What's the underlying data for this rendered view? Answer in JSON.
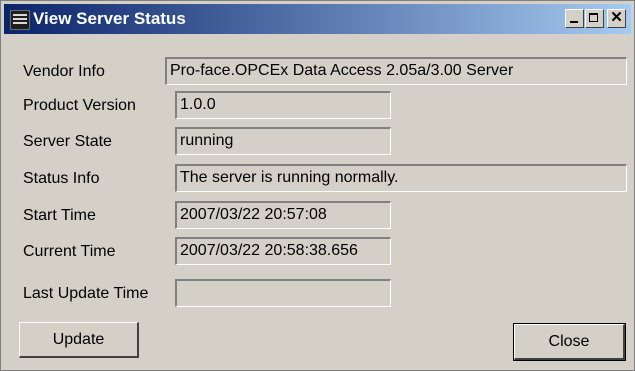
{
  "window": {
    "title": "View Server Status",
    "icon": "app-icon"
  },
  "titlebar_buttons": {
    "minimize_icon": "minimize-icon",
    "maximize_icon": "maximize-icon",
    "close_icon": "close-icon",
    "close_glyph": "✕"
  },
  "fields": [
    {
      "label": "Vendor Info",
      "value": "Pro-face.OPCEx Data Access 2.05a/3.00 Server"
    },
    {
      "label": "Product Version",
      "value": "1.0.0"
    },
    {
      "label": "Server State",
      "value": "running"
    },
    {
      "label": "Status Info",
      "value": "The server is running normally."
    },
    {
      "label": "Start Time",
      "value": "2007/03/22 20:57:08"
    },
    {
      "label": "Current Time",
      "value": "2007/03/22 20:58:38.656"
    },
    {
      "label": "Last Update Time",
      "value": ""
    }
  ],
  "buttons": {
    "update_label": "Update",
    "close_label": "Close"
  },
  "colors": {
    "titlebar_start": "#0a246a",
    "titlebar_end": "#a6caf0",
    "face": "#d4d0c8"
  }
}
